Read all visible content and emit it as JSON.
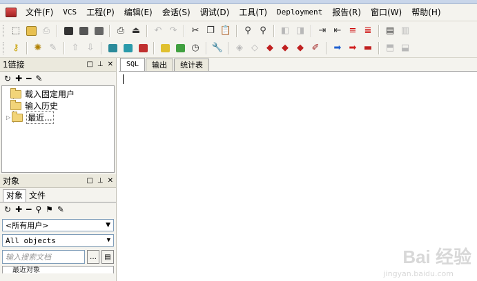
{
  "menubar": {
    "items": [
      "文件(F)",
      "VCS",
      "工程(P)",
      "编辑(E)",
      "会话(S)",
      "调试(D)",
      "工具(T)",
      "Deployment",
      "报告(R)",
      "窗口(W)",
      "帮助(H)"
    ]
  },
  "toolbar1": {
    "icons": [
      "new-icon",
      "open-icon",
      "print-icon",
      "save-icon",
      "save-all-icon",
      "save-as-icon",
      "print-preview-icon",
      "close-icon",
      "undo-icon",
      "redo-icon",
      "cut-icon",
      "copy-icon",
      "paste-icon",
      "find-icon",
      "find-next-icon",
      "back-icon",
      "forward-icon",
      "indent-icon",
      "unindent-icon",
      "comment-icon",
      "uncomment-icon",
      "run-icon",
      "compile-icon"
    ]
  },
  "toolbar2": {
    "icons": [
      "key-icon",
      "settings-icon",
      "pen-icon",
      "upload-icon",
      "download-icon",
      "sql-icon",
      "connect-icon",
      "disconnect-icon",
      "tools-icon",
      "check-icon",
      "clock-icon",
      "wrench-icon",
      "step-icon",
      "erase-icon",
      "stop-icon",
      "break-icon",
      "debug-icon",
      "brush-icon",
      "arrow-right-blue-icon",
      "arrow-right-red-icon",
      "redline-icon"
    ]
  },
  "connections_pane": {
    "title": "1链接",
    "tree": [
      "载入固定用户",
      "输入历史",
      "最近..."
    ]
  },
  "objects_pane": {
    "title": "对象",
    "tabs": [
      "对象",
      "文件"
    ],
    "user_select": "<所有用户>",
    "type_select": "All objects",
    "search_placeholder": "输入搜索文档",
    "partial_row": "最近对象"
  },
  "editor": {
    "tabs": [
      "SQL",
      "输出",
      "统计表"
    ]
  },
  "watermark": {
    "brand": "Bai 经验",
    "url": "jingyan.baidu.com"
  },
  "colors": {
    "menubar_bg": "#f4f3ee",
    "selection_border": "#7f9db9"
  }
}
